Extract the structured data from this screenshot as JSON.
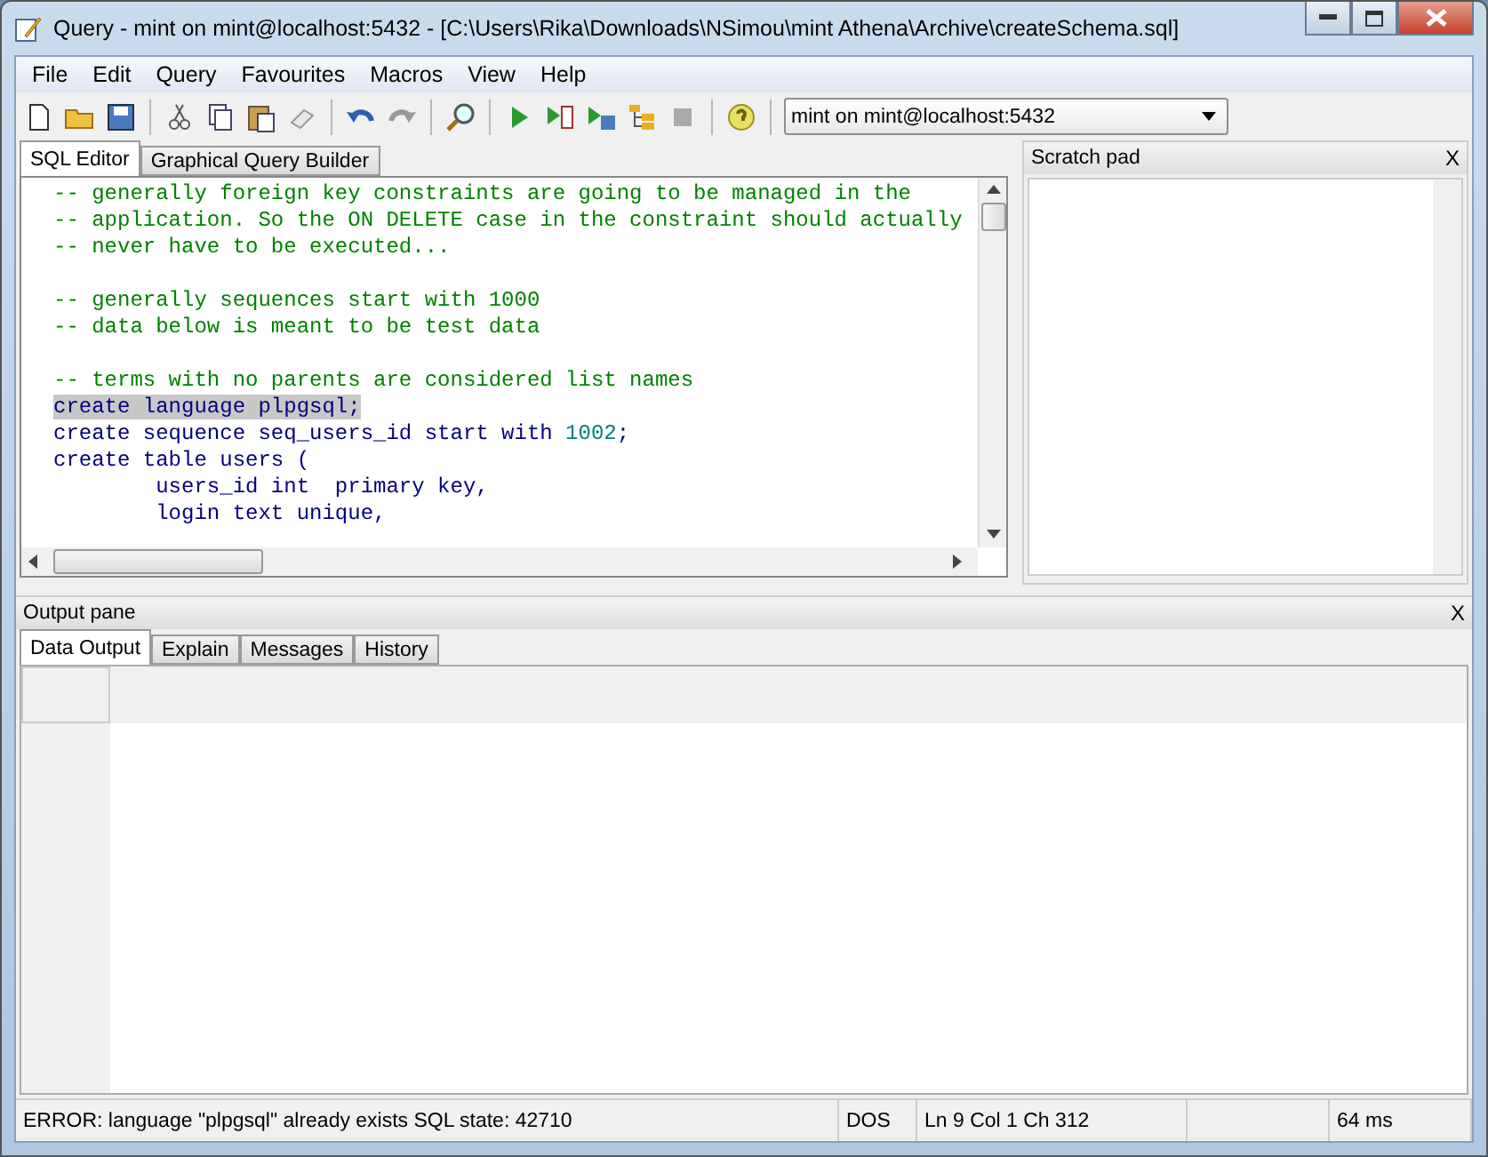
{
  "window": {
    "title": "Query - mint on mint@localhost:5432 - [C:\\Users\\Rika\\Downloads\\NSimou\\mint Athena\\Archive\\createSchema.sql]"
  },
  "menu": [
    "File",
    "Edit",
    "Query",
    "Favourites",
    "Macros",
    "View",
    "Help"
  ],
  "toolbar": {
    "connection": "mint on mint@localhost:5432"
  },
  "editor_tabs": [
    {
      "label": "SQL Editor",
      "selected": true
    },
    {
      "label": "Graphical Query Builder",
      "selected": false
    }
  ],
  "code_blocks": [
    [
      {
        "highlighted": false,
        "segments": [
          {
            "kind": "comment",
            "text": "-- generally foreign key constraints are going to be managed in the"
          }
        ]
      },
      {
        "highlighted": false,
        "segments": [
          {
            "kind": "comment",
            "text": "-- application. So the ON DELETE case in the constraint should actually"
          }
        ]
      },
      {
        "highlighted": false,
        "segments": [
          {
            "kind": "comment",
            "text": "-- never have to be executed..."
          }
        ]
      }
    ],
    [
      {
        "highlighted": false,
        "segments": [
          {
            "kind": "comment",
            "text": "-- generally sequences start with 1000"
          }
        ]
      },
      {
        "highlighted": false,
        "segments": [
          {
            "kind": "comment",
            "text": "-- data below is meant to be test data"
          }
        ]
      }
    ],
    [
      {
        "highlighted": false,
        "segments": [
          {
            "kind": "comment",
            "text": "-- terms with no parents are considered list names"
          }
        ]
      },
      {
        "highlighted": true,
        "segments": [
          {
            "kind": "code",
            "text": "create language plpgsql;"
          }
        ]
      },
      {
        "highlighted": false,
        "segments": [
          {
            "kind": "code",
            "text": "create sequence seq_users_id start with "
          },
          {
            "kind": "number",
            "text": "1002"
          },
          {
            "kind": "code",
            "text": ";"
          }
        ]
      },
      {
        "highlighted": false,
        "segments": [
          {
            "kind": "code",
            "text": "create table users ("
          }
        ]
      },
      {
        "highlighted": false,
        "segments": [
          {
            "kind": "code",
            "text": "        users_id int  primary key,"
          }
        ]
      },
      {
        "highlighted": false,
        "segments": [
          {
            "kind": "code",
            "text": "        login text unique,"
          }
        ]
      }
    ]
  ],
  "scratch_pad": {
    "title": "Scratch pad",
    "close": "X"
  },
  "output_pane": {
    "title": "Output pane",
    "close": "X"
  },
  "output_tabs": [
    {
      "label": "Data Output",
      "selected": true
    },
    {
      "label": "Explain",
      "selected": false
    },
    {
      "label": "Messages",
      "selected": false
    },
    {
      "label": "History",
      "selected": false
    }
  ],
  "status_bar": {
    "message": "ERROR: language \"plpgsql\" already exists SQL state: 42710",
    "encoding": "DOS",
    "position": "Ln 9 Col 1 Ch 312",
    "time": "64 ms"
  }
}
